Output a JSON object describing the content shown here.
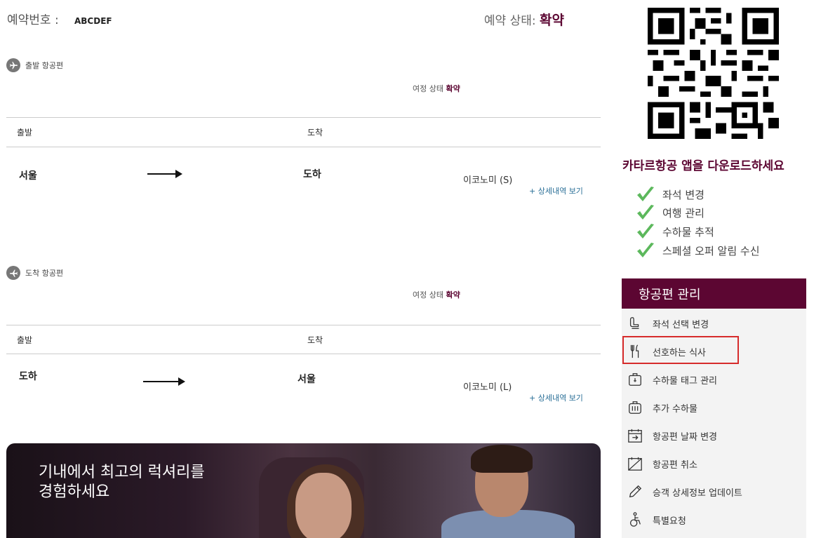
{
  "header": {
    "booking_label": "예약번호 :",
    "booking_code": "ABCDEF",
    "status_label": "예약 상태:",
    "status_value": "확약"
  },
  "outbound": {
    "section_title": "출발 항공편",
    "trip_status_label": "여정 상태",
    "trip_status_value": "확약",
    "col_departure": "출발",
    "col_arrival": "도착",
    "from": "서울",
    "to": "도하",
    "cabin": "이코노미 (S)",
    "details_link": "+ 상세내역 보기"
  },
  "inbound": {
    "section_title": "도착 항공편",
    "trip_status_label": "여정 상태",
    "trip_status_value": "확약",
    "col_departure": "출발",
    "col_arrival": "도착",
    "from": "도하",
    "to": "서울",
    "cabin": "이코노미 (L)",
    "details_link": "+ 상세내역 보기"
  },
  "banner": {
    "title": "기내에서 최고의 럭셔리를\n경험하세요"
  },
  "sidebar": {
    "app_promo": "카타르항공 앱을 다운로드하세요",
    "features": [
      "좌석 변경",
      "여행 관리",
      "수하물 추적",
      "스페셜 오퍼 알림 수신"
    ],
    "manage_title": "항공편 관리",
    "manage_items": [
      {
        "label": "좌석 선택 변경",
        "icon": "seat-icon"
      },
      {
        "label": "선호하는 식사",
        "icon": "meal-icon"
      },
      {
        "label": "수하물 태그 관리",
        "icon": "baggage-tag-icon"
      },
      {
        "label": "추가 수하물",
        "icon": "extra-baggage-icon"
      },
      {
        "label": "항공편 날짜 변경",
        "icon": "calendar-change-icon"
      },
      {
        "label": "항공편 취소",
        "icon": "cancel-flight-icon"
      },
      {
        "label": "승객 상세정보 업데이트",
        "icon": "pencil-icon"
      },
      {
        "label": "특별요청",
        "icon": "wheelchair-icon"
      }
    ]
  },
  "colors": {
    "brand_maroon": "#5c0632",
    "link_blue": "#2a6f97",
    "highlight_red": "#d62b2b",
    "check_green": "#5cb85c"
  }
}
